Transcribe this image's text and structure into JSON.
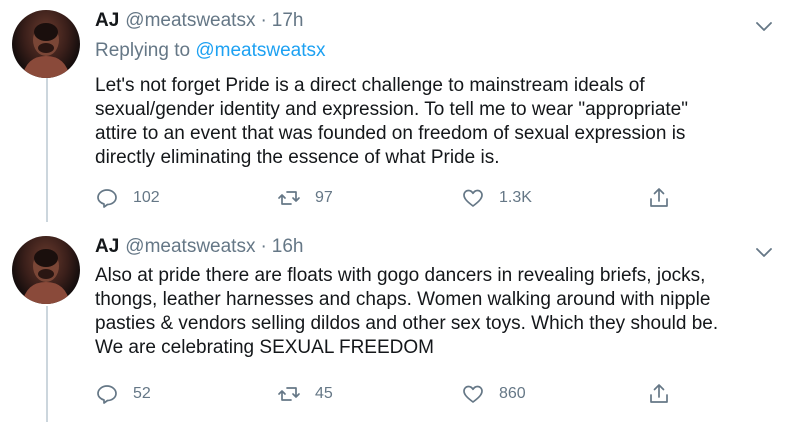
{
  "tweets": [
    {
      "name": "AJ",
      "handle": "@meatsweatsx",
      "dot": "·",
      "time": "17h",
      "replying_prefix": "Replying to",
      "replying_handle": "@meatsweatsx",
      "lines": [
        "Let's not forget Pride is a direct challenge to mainstream ideals of",
        "sexual/gender identity and expression. To tell me to wear \"appropriate\"",
        "attire to an event that was founded on freedom of sexual expression is",
        "directly eliminating the essence of what Pride is."
      ],
      "replies": "102",
      "retweets": "97",
      "likes": "1.3K"
    },
    {
      "name": "AJ",
      "handle": "@meatsweatsx",
      "dot": "·",
      "time": "16h",
      "lines": [
        "Also at pride there are floats with gogo dancers in revealing briefs, jocks,",
        "thongs, leather harnesses and chaps. Women walking around with nipple",
        "pasties & vendors selling dildos and other sex toys. Which they should be.",
        "We are celebrating SEXUAL FREEDOM"
      ],
      "replies": "52",
      "retweets": "45",
      "likes": "860"
    }
  ],
  "icons": {
    "reply": "reply-icon",
    "retweet": "retweet-icon",
    "like": "heart-icon",
    "share": "share-icon",
    "caret": "chevron-down-icon"
  },
  "colors": {
    "text": "#14171a",
    "muted": "#657786",
    "link": "#1da1f2",
    "thread_line": "#ccd6dd"
  }
}
